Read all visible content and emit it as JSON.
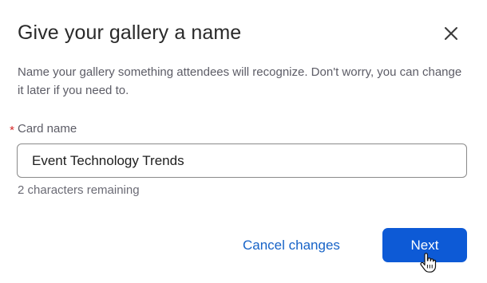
{
  "dialog": {
    "title": "Give your gallery a name",
    "description": "Name your gallery something attendees will recognize. Don't worry, you can change it later if you need to.",
    "close_icon": "close-icon"
  },
  "field": {
    "required_mark": "*",
    "label": "Card name",
    "value": "Event Technology Trends",
    "helper": "2 characters remaining"
  },
  "actions": {
    "cancel_label": "Cancel changes",
    "next_label": "Next"
  },
  "colors": {
    "primary": "#0d5ad6",
    "link": "#1763c7",
    "required": "#d62828"
  }
}
